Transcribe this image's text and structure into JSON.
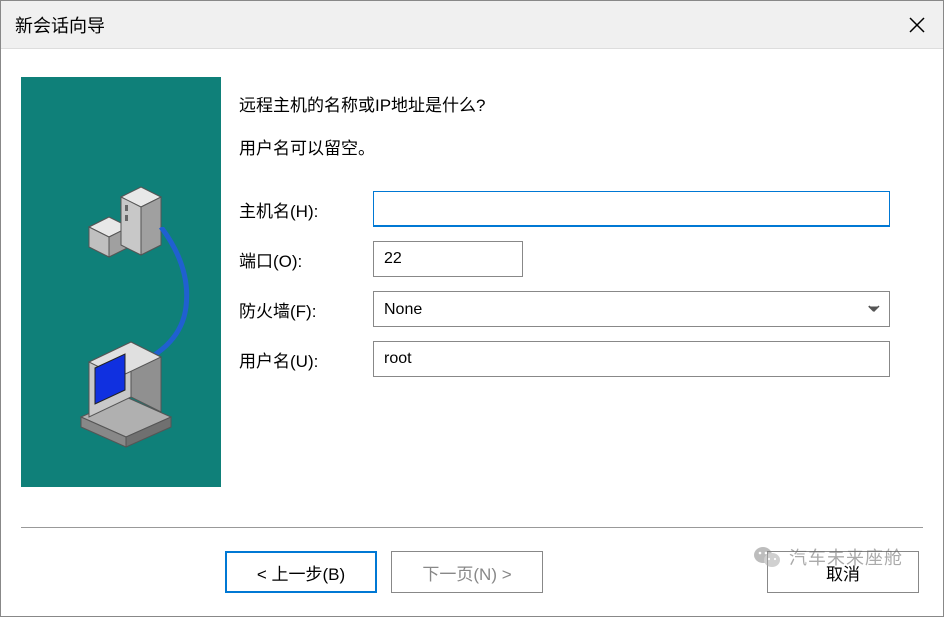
{
  "titlebar": {
    "title": "新会话向导"
  },
  "form": {
    "heading": "远程主机的名称或IP地址是什么?",
    "subheading": "用户名可以留空。",
    "hostname_label": "主机名(H):",
    "hostname_value": "",
    "port_label": "端口(O):",
    "port_value": "22",
    "firewall_label": "防火墙(F):",
    "firewall_value": "None",
    "username_label": "用户名(U):",
    "username_value": "root"
  },
  "buttons": {
    "back": "< 上一步(B)",
    "next": "下一页(N) >",
    "cancel": "取消"
  },
  "watermark": {
    "text": "汽车未来座舱"
  }
}
